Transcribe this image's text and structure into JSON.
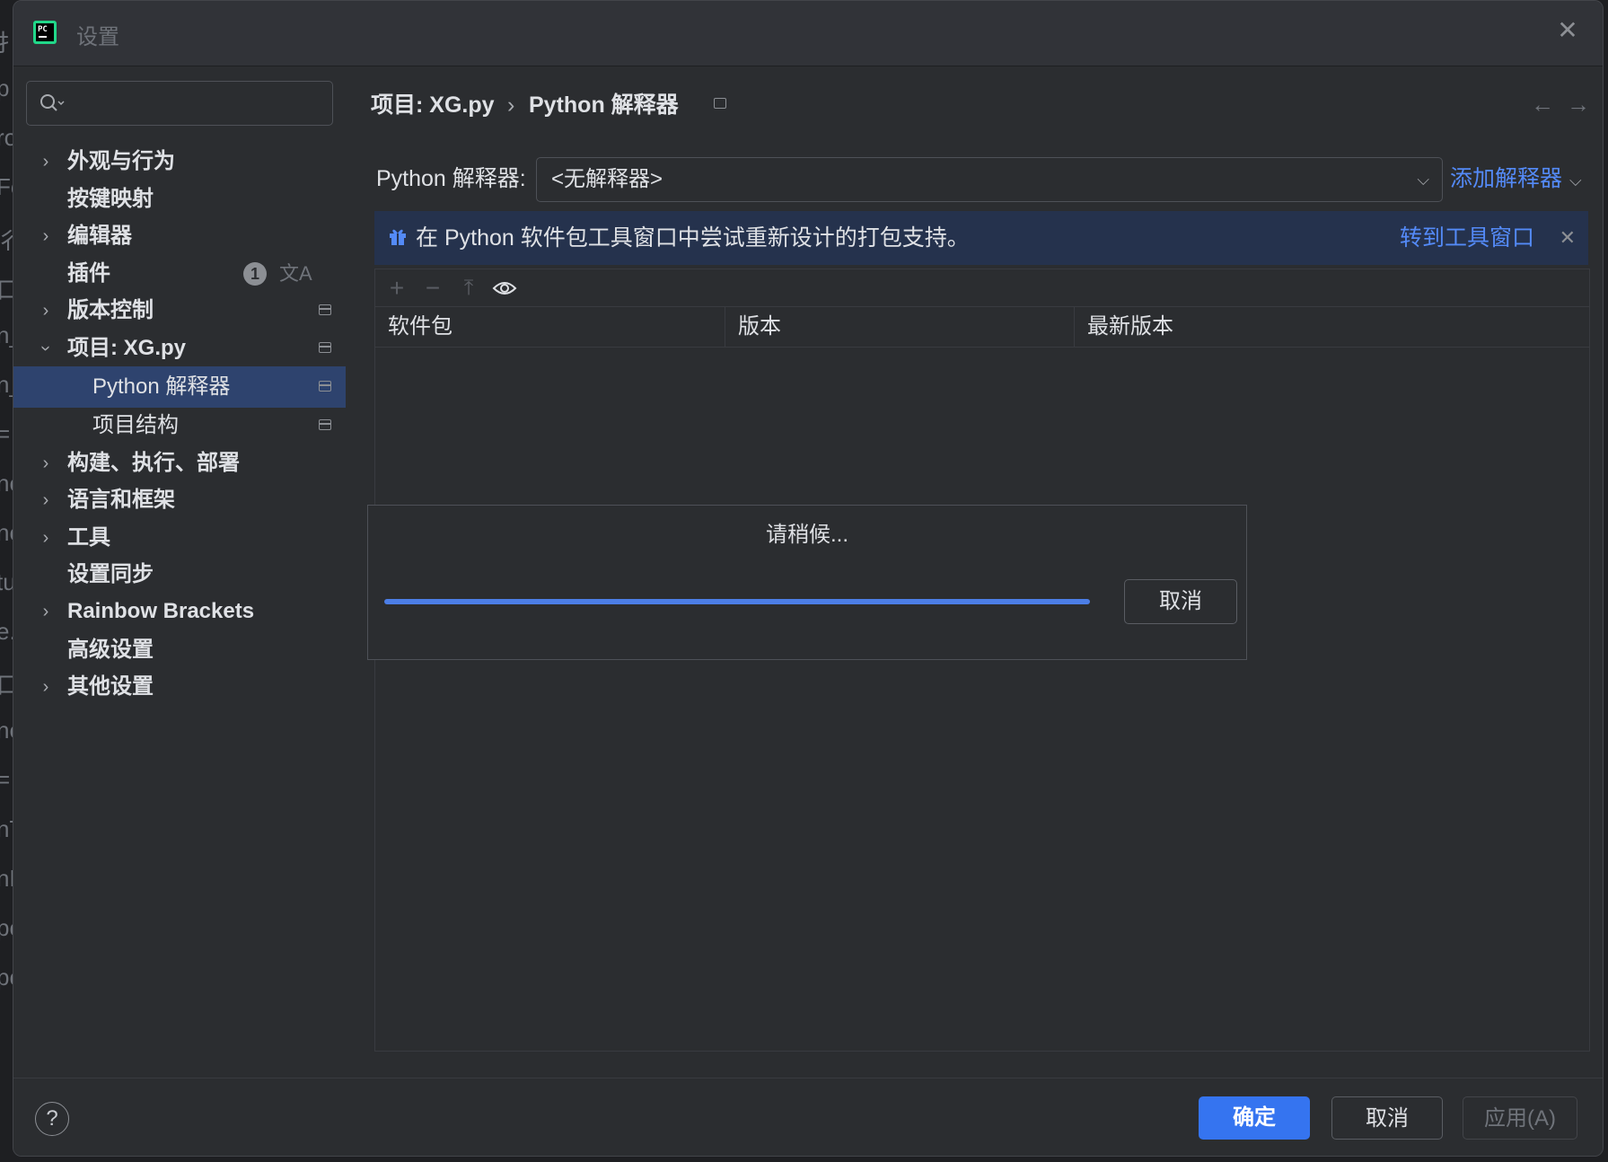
{
  "background_code_fragments": [
    "扌",
    "p",
    "ro",
    "Fo",
    "彳",
    "口",
    "n_",
    "n_",
    "=",
    "ne",
    "ne",
    "tu",
    "e.",
    "口",
    "ne",
    "=",
    "nT",
    "nE",
    "pc",
    "pc"
  ],
  "window": {
    "title": "设置"
  },
  "search": {
    "placeholder": ""
  },
  "sidebar": {
    "items": [
      {
        "label": "外观与行为"
      },
      {
        "label": "按键映射"
      },
      {
        "label": "编辑器"
      },
      {
        "label": "插件",
        "badge": "1"
      },
      {
        "label": "版本控制"
      },
      {
        "label": "项目: XG.py"
      },
      {
        "label": "Python 解释器"
      },
      {
        "label": "项目结构"
      },
      {
        "label": "构建、执行、部署"
      },
      {
        "label": "语言和框架"
      },
      {
        "label": "工具"
      },
      {
        "label": "设置同步"
      },
      {
        "label": "Rainbow Brackets"
      },
      {
        "label": "高级设置"
      },
      {
        "label": "其他设置"
      }
    ]
  },
  "breadcrumb": {
    "project": "项目: XG.py",
    "separator": "›",
    "page": "Python 解释器"
  },
  "interpreter": {
    "label": "Python 解释器:",
    "selected": "<无解释器>",
    "add_label": "添加解释器"
  },
  "banner": {
    "text": "在 Python 软件包工具窗口中尝试重新设计的打包支持。",
    "link": "转到工具窗口"
  },
  "table": {
    "columns": [
      "软件包",
      "版本",
      "最新版本"
    ]
  },
  "wait_dialog": {
    "message": "请稍候...",
    "cancel": "取消",
    "progress": 1.0
  },
  "footer": {
    "help": "?",
    "ok": "确定",
    "cancel": "取消",
    "apply": "应用(A)"
  },
  "colors": {
    "accent": "#3574f0",
    "link": "#548af7",
    "selection": "#2e436e",
    "banner": "#25324d"
  }
}
